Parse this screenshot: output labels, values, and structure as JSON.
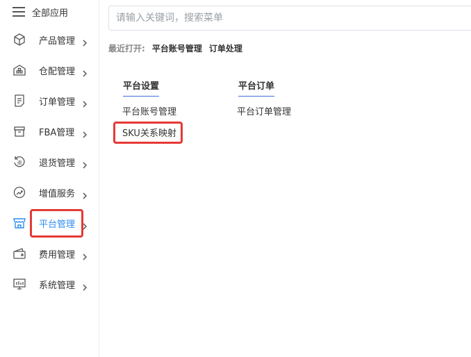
{
  "sidebar": {
    "all_apps_label": "全部应用",
    "items": [
      {
        "label": "产品管理",
        "icon": "cube-icon"
      },
      {
        "label": "仓配管理",
        "icon": "warehouse-icon"
      },
      {
        "label": "订单管理",
        "icon": "document-icon"
      },
      {
        "label": "FBA管理",
        "icon": "box-icon"
      },
      {
        "label": "退货管理",
        "icon": "return-icon"
      },
      {
        "label": "增值服务",
        "icon": "value-added-icon"
      },
      {
        "label": "平台管理",
        "icon": "store-icon",
        "active": true
      },
      {
        "label": "费用管理",
        "icon": "wallet-icon"
      },
      {
        "label": "系统管理",
        "icon": "monitor-icon"
      }
    ]
  },
  "search": {
    "placeholder": "请输入关键词，搜索菜单"
  },
  "recent": {
    "label": "最近打开:",
    "links": [
      "平台账号管理",
      "订单处理"
    ]
  },
  "columns": [
    {
      "header": "平台设置",
      "links": [
        "平台账号管理",
        "SKU关系映射"
      ]
    },
    {
      "header": "平台订单",
      "links": [
        "平台订单管理"
      ]
    }
  ],
  "colors": {
    "accent": "#2d8cf0",
    "highlight": "#e53935",
    "header_underline": "#3b6fd4"
  }
}
